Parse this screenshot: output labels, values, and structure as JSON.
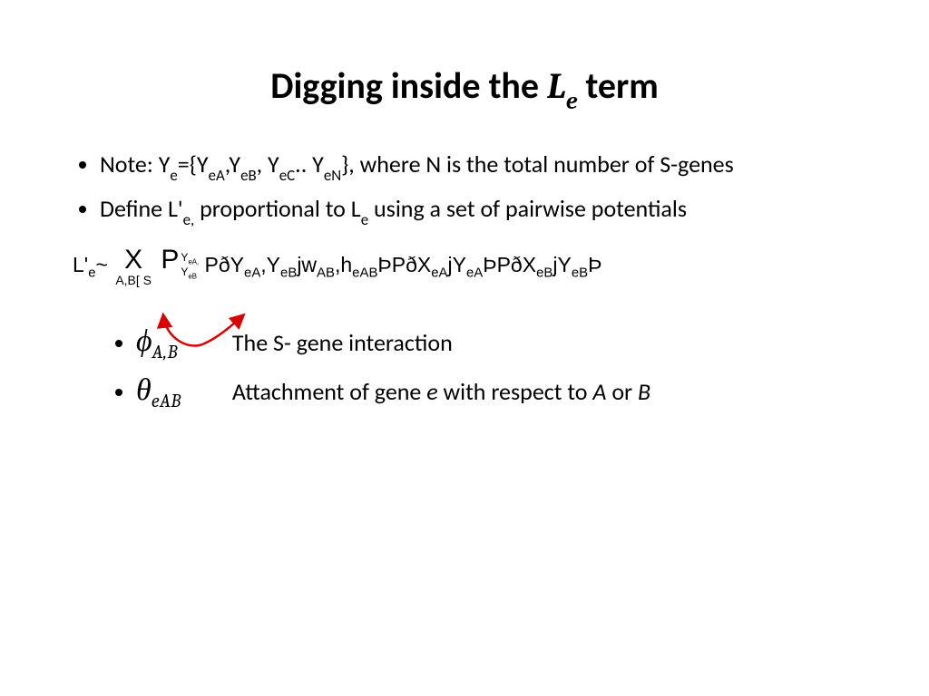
{
  "title": {
    "prefix": "Digging inside the ",
    "L": "L",
    "Lsub": "e",
    "suffix": " term"
  },
  "bullets": {
    "b1_pre": "Note: Y",
    "b1_sub1": "e",
    "b1_mid1": "={Y",
    "b1_sub2": "eA",
    "b1_mid2": ",Y",
    "b1_sub3": "eB",
    "b1_mid3": ", Y",
    "b1_sub4": "eC",
    "b1_mid4": ".. Y",
    "b1_sub5": "eN",
    "b1_post": "}, where N is the total number of S-genes",
    "b2_pre": "Define L'",
    "b2_sub1": "e,",
    "b2_mid1": " proportional to L",
    "b2_sub2": "e",
    "b2_post": " using a set of pairwise potentials"
  },
  "formula": {
    "Lprime_e": "L'",
    "Lprime_sub": "e",
    "tilde": "~",
    "prod_sym": "X",
    "prod_sub": "A,B[ S",
    "sum_sym": "P",
    "sum_ysub1": "Y",
    "sum_ysub1s": "eA,",
    "sum_ysub2": "Y",
    "sum_ysub2s": "eB",
    "body_p1": "PðY",
    "body_s1": "eA",
    "body_p2": ",Y",
    "body_s2": "eB",
    "body_p3": "jw",
    "body_s3": "AB",
    "body_p4": ",h",
    "body_s4": "eAB",
    "body_p5": "ÞPðX",
    "body_s5": "eA",
    "body_p6": "jY",
    "body_s6": "eA",
    "body_p7": "ÞPðX",
    "body_s7": "eB",
    "body_p8": "jY",
    "body_s8": "eB",
    "body_p9": "Þ"
  },
  "defs": {
    "phi": "ϕ",
    "phi_sub": "A,B",
    "phi_text": "The S- gene interaction",
    "theta": "θ",
    "theta_sub": "eAB",
    "theta_text_pre": "Attachment of gene ",
    "theta_e": "e",
    "theta_text_mid": " with respect to ",
    "theta_A": "A",
    "theta_text_or": " or ",
    "theta_B": "B"
  }
}
